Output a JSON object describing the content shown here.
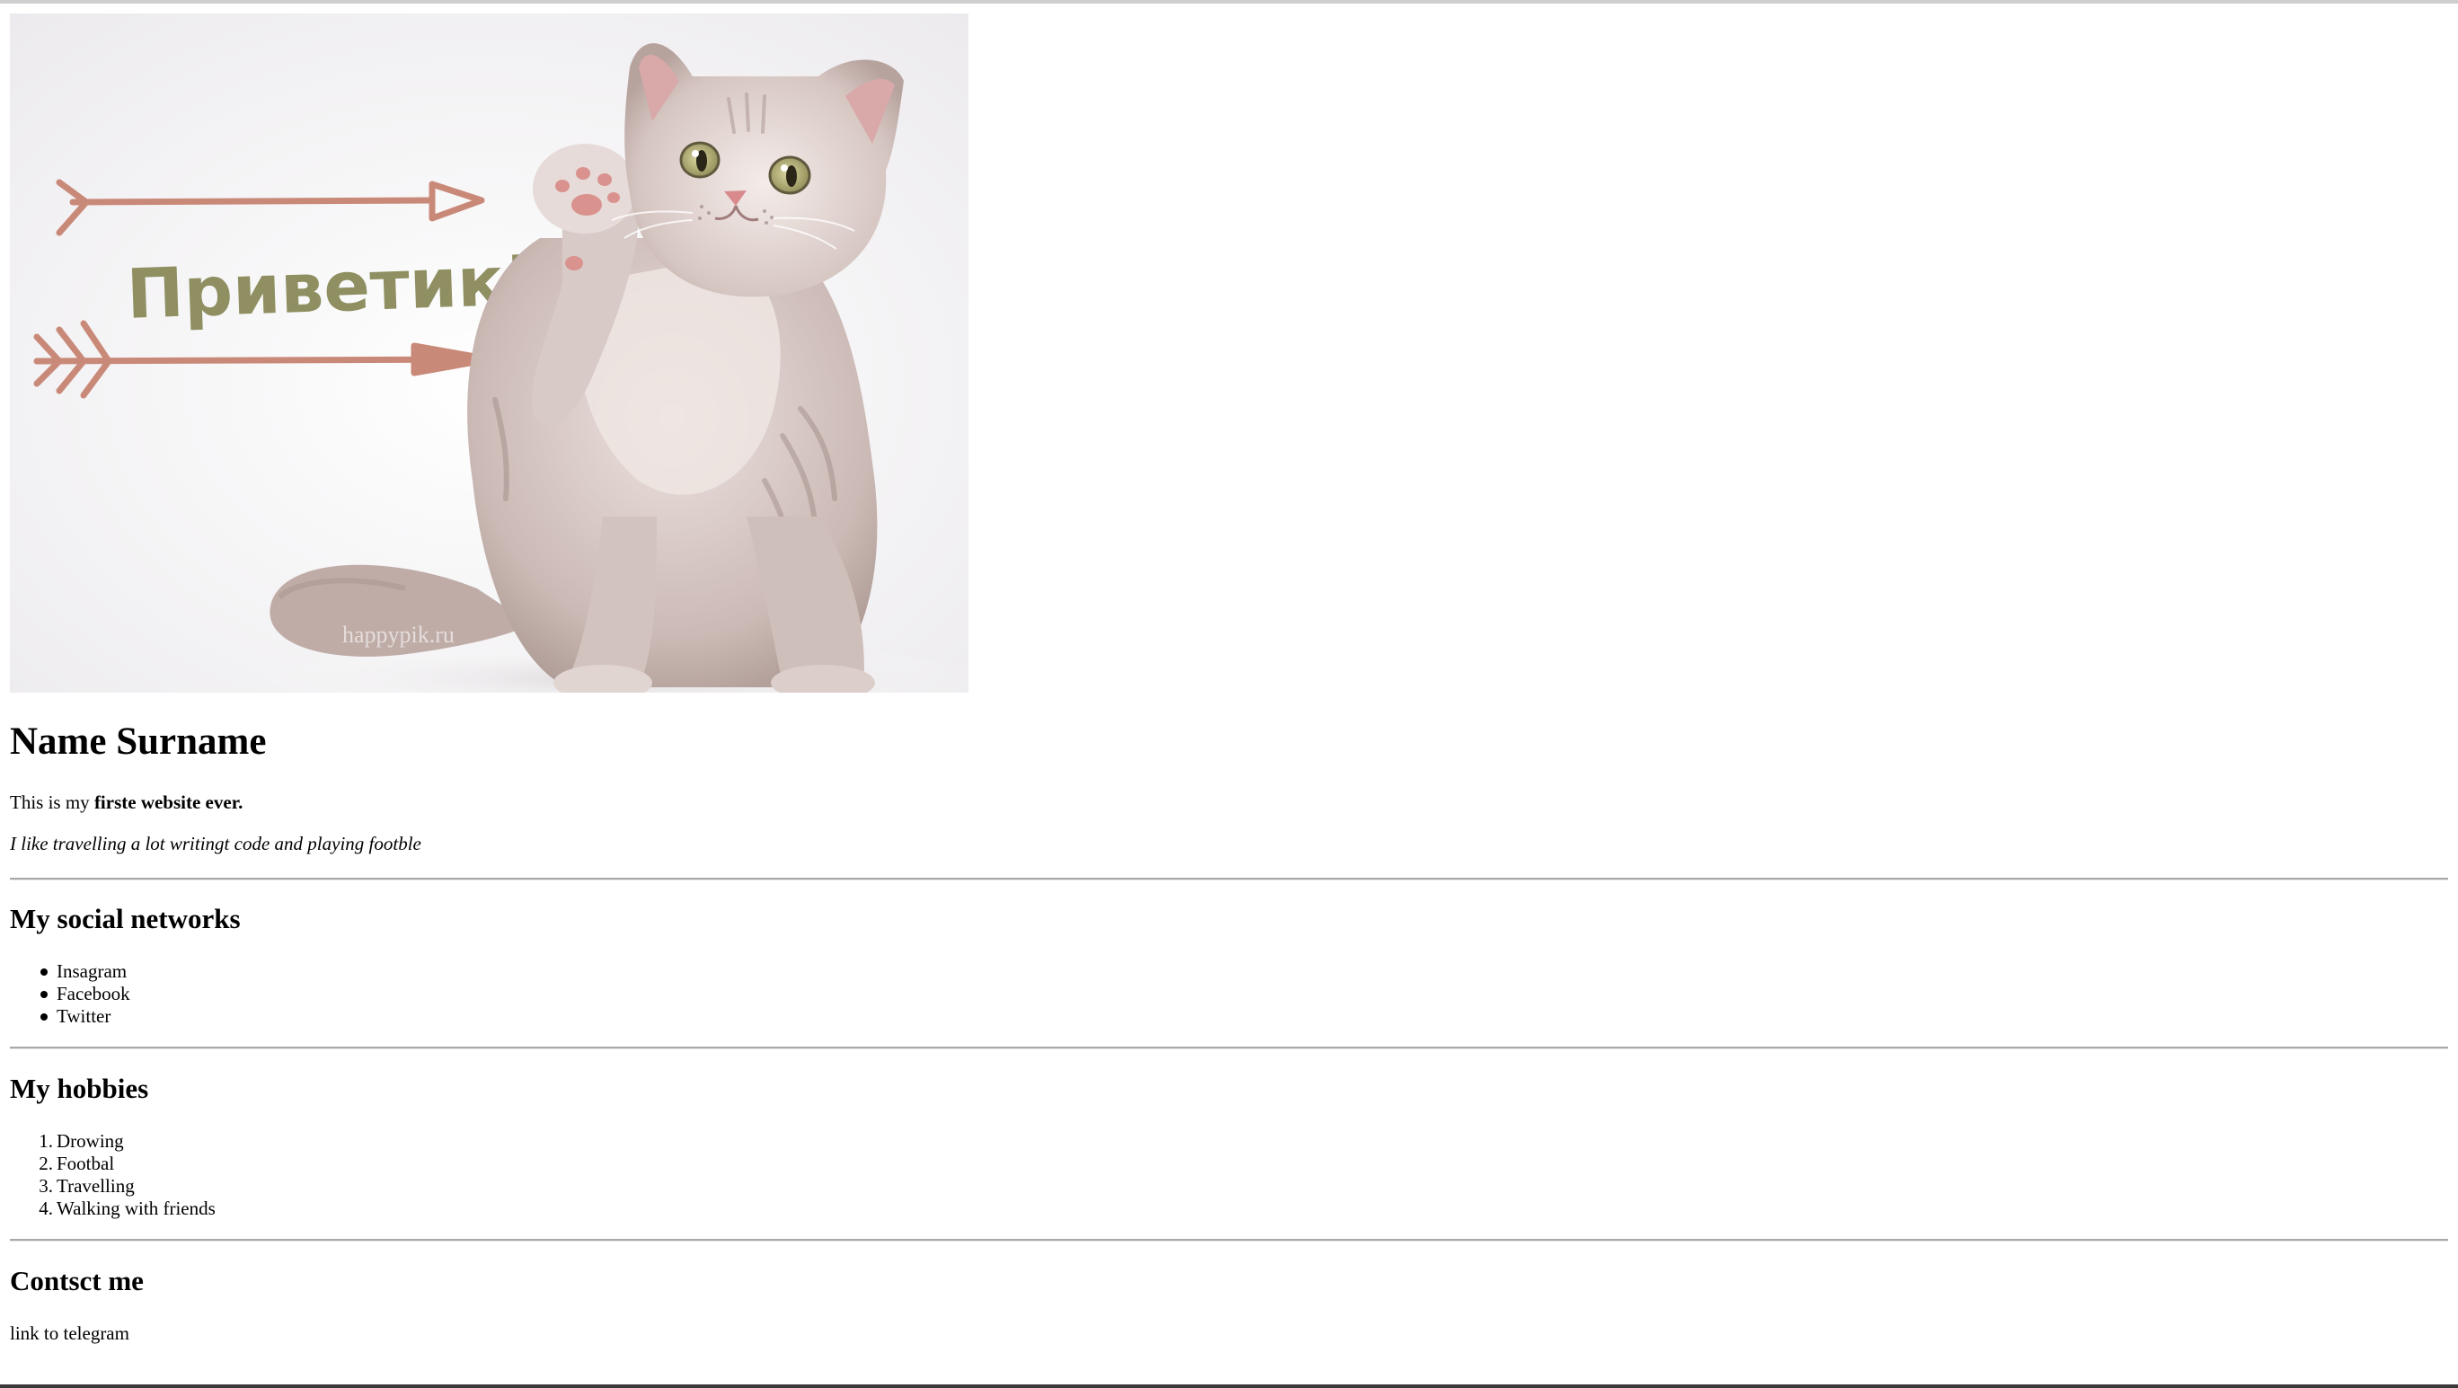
{
  "hero": {
    "greeting": "Приветик!",
    "watermark": "happypik.ru"
  },
  "profile": {
    "name": "Name Surname",
    "intro_prefix": "This is my ",
    "intro_strong": "firste website ever.",
    "likes": "I like travelling a lot writingt code and playing footble"
  },
  "social": {
    "heading": "My social networks",
    "items": [
      "Insagram",
      "Facebook",
      "Twitter"
    ]
  },
  "hobbies": {
    "heading": "My hobbies",
    "items": [
      {
        "num": "1.",
        "label": "Drowing"
      },
      {
        "num": "2.",
        "label": "Footbal"
      },
      {
        "num": "3.",
        "label": "Travelling"
      },
      {
        "num": "4.",
        "label": "Walking with friends"
      }
    ]
  },
  "contact": {
    "heading": "Contsct me",
    "link_text": "link to telegram"
  },
  "colors": {
    "arrow": "#c98978",
    "greeting": "#8f8f62",
    "rule": "#a9a9a9"
  }
}
